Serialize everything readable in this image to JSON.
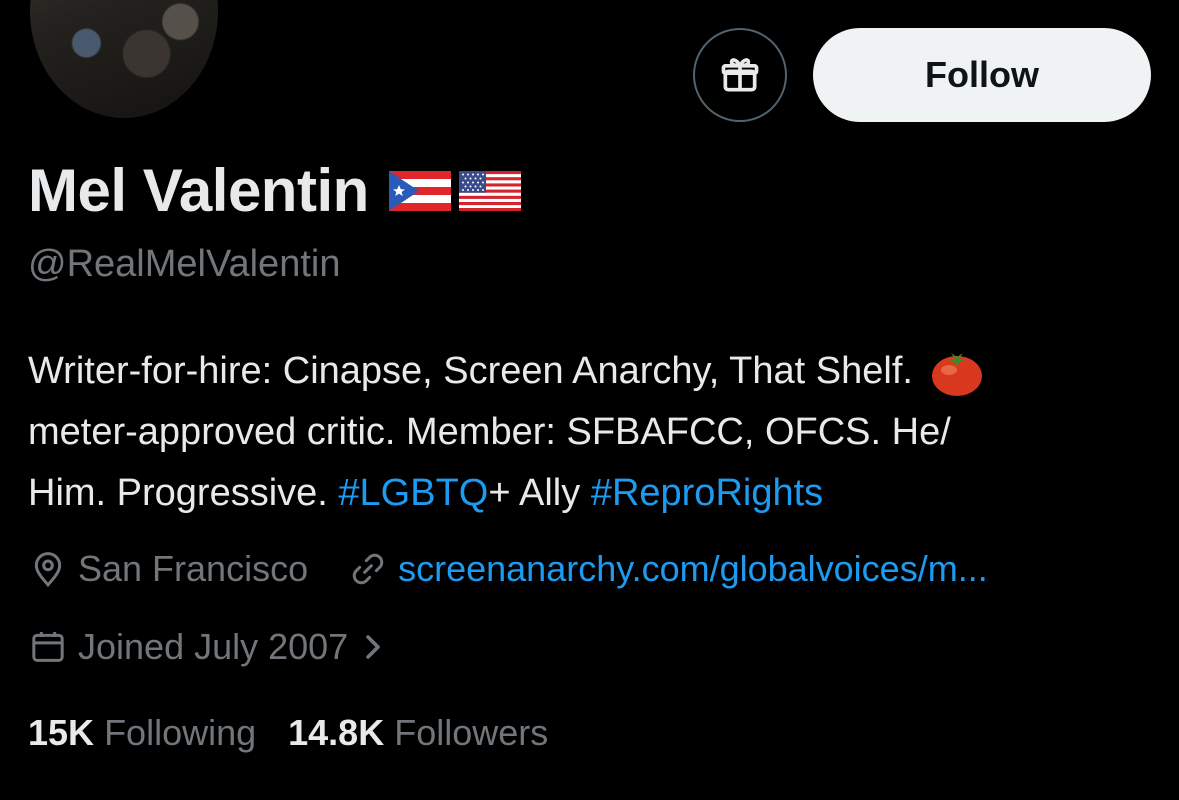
{
  "profile": {
    "display_name": "Mel Valentin",
    "name_flags": [
      "puerto-rico-flag",
      "usa-flag"
    ],
    "handle": "@RealMelValentin",
    "bio": {
      "part1": "Writer-for-hire: Cinapse, Screen Anarchy, That Shelf.",
      "part2": "meter-approved critic. Member: SFBAFCC, OFCS. He/",
      "part3": "Him. Progressive.",
      "hashtag1": "#LGBTQ",
      "part4": "+ Ally",
      "hashtag2": "#ReproRights"
    },
    "location": "San Francisco",
    "website": "screenanarchy.com/globalvoices/m...",
    "joined": "Joined July 2007",
    "following_count": "15K",
    "following_label": "Following",
    "followers_count": "14.8K",
    "followers_label": "Followers"
  },
  "actions": {
    "follow_label": "Follow",
    "gift_icon": "gift-icon"
  },
  "colors": {
    "background": "#000000",
    "text_primary": "#e7e9ea",
    "text_secondary": "#71767b",
    "link": "#1d9bf0",
    "follow_bg": "#eff3f4"
  }
}
